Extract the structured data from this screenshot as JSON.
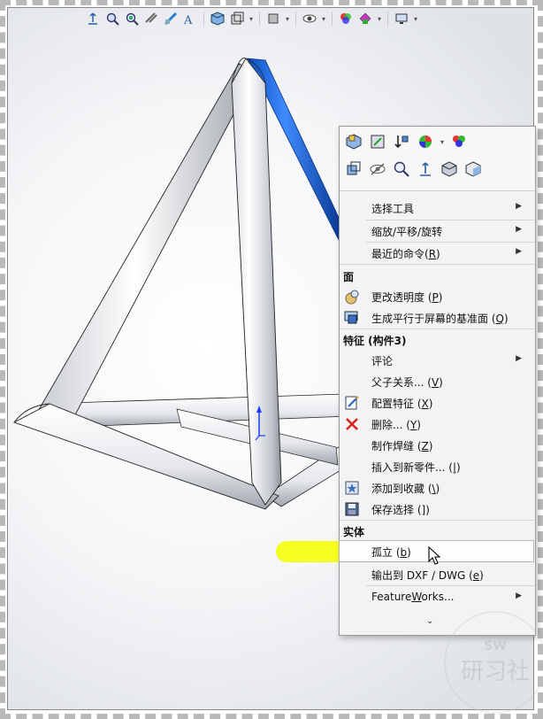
{
  "hud_toolbar": {
    "icons": [
      "view-orientation-icon",
      "zoom-to-fit-icon",
      "zoom-to-area-icon",
      "previous-view-icon",
      "section-view-icon",
      "dynamic-annotation-icon",
      "view-orientation-box-icon",
      "display-style-icon",
      "hide-show-items-icon",
      "edit-appearance-icon",
      "apply-scene-icon",
      "view-settings-icon"
    ]
  },
  "context_menu": {
    "toolbar_icons": [
      "edit-feature-icon",
      "edit-sketch-icon",
      "rollback-icon",
      "appearance-icon",
      "appearance-dropdown",
      "appearance-callout-icon",
      "select-other-icon",
      "hide-icon",
      "zoom-to-selection-icon",
      "normal-to-icon",
      "view-cube-icon",
      "isometric-icon"
    ],
    "items_top": [
      {
        "label": "选择工具",
        "submenu": true
      },
      {
        "label": "缩放/平移/旋转",
        "submenu": true
      },
      {
        "label": "最近的命令(",
        "accel": "R",
        "suffix": ")",
        "submenu": true
      }
    ],
    "section_face": "面",
    "items_face": [
      {
        "label": "更改透明度 (",
        "accel": "P",
        "suffix": ")",
        "icon": "transparency-icon"
      },
      {
        "label": "生成平行于屏幕的基准面 (",
        "accel": "Q",
        "suffix": ")",
        "icon": "plane-parallel-screen-icon"
      }
    ],
    "section_feature": "特征 (构件3)",
    "items_feature": [
      {
        "label": "评论",
        "submenu": true
      },
      {
        "label": "父子关系... (",
        "accel": "V",
        "suffix": ")"
      },
      {
        "label": "配置特征 (",
        "accel": "X",
        "suffix": ")",
        "icon": "configure-feature-icon"
      },
      {
        "label": "删除... (",
        "accel": "Y",
        "suffix": ")",
        "icon": "delete-icon"
      },
      {
        "label": "制作焊缝 (",
        "accel": "Z",
        "suffix": ")"
      },
      {
        "label": "插入到新零件... (",
        "accel": "|",
        "suffix": ")"
      },
      {
        "label": "添加到收藏 (",
        "accel": "\\",
        "suffix": ")",
        "icon": "add-favorite-icon"
      },
      {
        "label": "保存选择 (",
        "accel": "]",
        "suffix": ")",
        "icon": "save-selection-icon"
      }
    ],
    "section_body": "实体",
    "items_body": [
      {
        "label": "孤立 (",
        "accel": "b",
        "suffix": ")",
        "highlighted": true
      },
      {
        "label": "输出到 DXF / DWG (",
        "accel": "e",
        "suffix": ")"
      },
      {
        "label": "Feature",
        "accel": "W",
        "suffix": "orks...",
        "submenu": true
      }
    ],
    "more_glyph": "⌄"
  },
  "watermark": {
    "line1": "SW",
    "line2": "研习社"
  },
  "colors": {
    "selected_edge": "#1a63d6",
    "highlighter": "#f4ff14",
    "triad_blue": "#1a3cff"
  }
}
